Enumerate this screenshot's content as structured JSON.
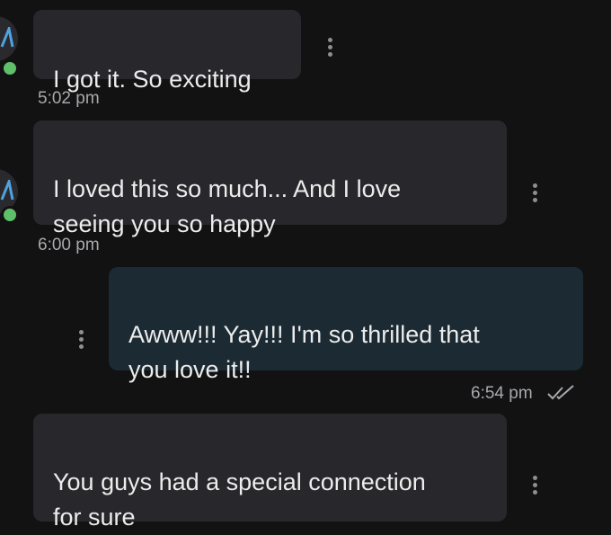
{
  "messages": [
    {
      "direction": "incoming",
      "text": "I got it. So exciting",
      "time": "5:02 pm"
    },
    {
      "direction": "incoming",
      "text": "I loved this so much... And I love\nseeing you so happy",
      "time": "6:00 pm"
    },
    {
      "direction": "outgoing",
      "text": "Awww!!! Yay!!! I'm so thrilled that\nyou love it!!",
      "time": "6:54 pm",
      "status": "read"
    },
    {
      "direction": "incoming",
      "text": "You guys had a special connection\nfor sure",
      "time": ""
    }
  ],
  "icons": {
    "avatar": "avatar-icon",
    "presence": "online-status-dot",
    "menu": "more-vertical-icon",
    "receipt": "double-check-icon"
  },
  "colors": {
    "background": "#121212",
    "incoming_bubble": "#28282c",
    "outgoing_bubble": "#1b2a33",
    "text": "#ececec",
    "timestamp": "#a8a8ad",
    "online": "#5ec06a",
    "kebab": "#8e8e93"
  }
}
